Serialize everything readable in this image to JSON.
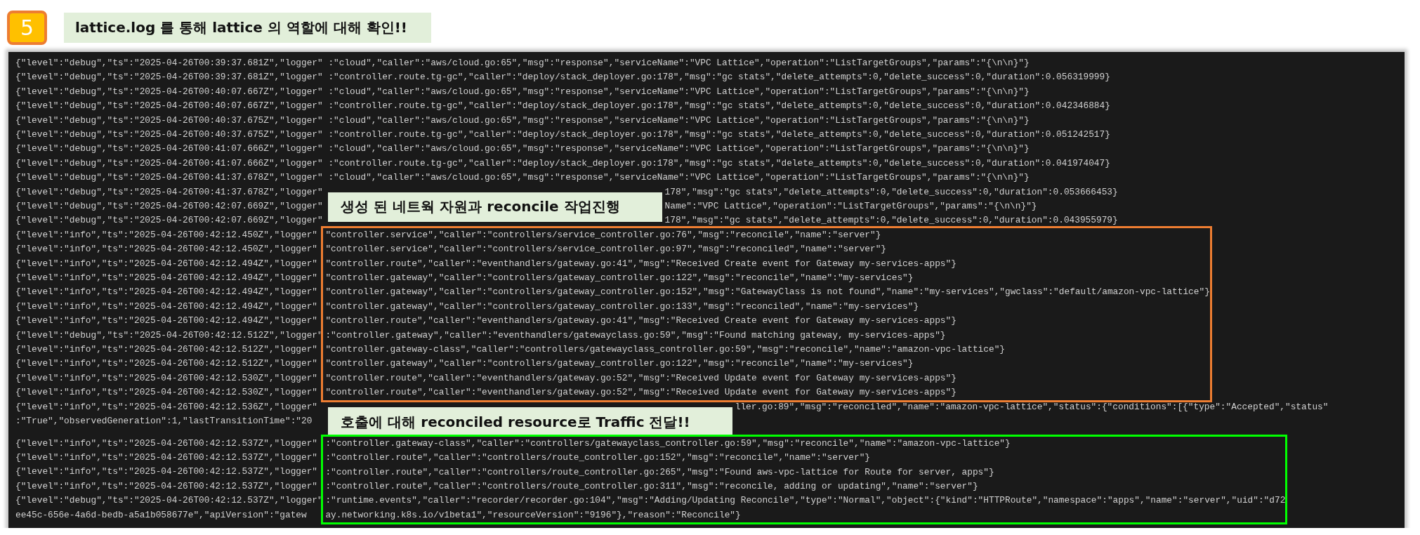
{
  "step_badge": "5",
  "title": "lattice.log 를 통해 lattice 의 역할에 대해 확인!!",
  "terminal": {
    "groups": [
      {
        "kind": "plain",
        "lines": [
          {
            "prefix": "{\"level\":\"debug\",\"ts\":\"2025-04-26T00:39:37.681Z\",\"logger\"",
            "rest": ":\"cloud\",\"caller\":\"aws/cloud.go:65\",\"msg\":\"response\",\"serviceName\":\"VPC Lattice\",\"operation\":\"ListTargetGroups\",\"params\":\"{\\n\\n}\"}"
          },
          {
            "prefix": "{\"level\":\"debug\",\"ts\":\"2025-04-26T00:39:37.681Z\",\"logger\"",
            "rest": ":\"controller.route.tg-gc\",\"caller\":\"deploy/stack_deployer.go:178\",\"msg\":\"gc stats\",\"delete_attempts\":0,\"delete_success\":0,\"duration\":0.056319999}"
          },
          {
            "prefix": "{\"level\":\"debug\",\"ts\":\"2025-04-26T00:40:07.667Z\",\"logger\"",
            "rest": ":\"cloud\",\"caller\":\"aws/cloud.go:65\",\"msg\":\"response\",\"serviceName\":\"VPC Lattice\",\"operation\":\"ListTargetGroups\",\"params\":\"{\\n\\n}\"}"
          },
          {
            "prefix": "{\"level\":\"debug\",\"ts\":\"2025-04-26T00:40:07.667Z\",\"logger\"",
            "rest": ":\"controller.route.tg-gc\",\"caller\":\"deploy/stack_deployer.go:178\",\"msg\":\"gc stats\",\"delete_attempts\":0,\"delete_success\":0,\"duration\":0.042346884}"
          },
          {
            "prefix": "{\"level\":\"debug\",\"ts\":\"2025-04-26T00:40:37.675Z\",\"logger\"",
            "rest": ":\"cloud\",\"caller\":\"aws/cloud.go:65\",\"msg\":\"response\",\"serviceName\":\"VPC Lattice\",\"operation\":\"ListTargetGroups\",\"params\":\"{\\n\\n}\"}"
          },
          {
            "prefix": "{\"level\":\"debug\",\"ts\":\"2025-04-26T00:40:37.675Z\",\"logger\"",
            "rest": ":\"controller.route.tg-gc\",\"caller\":\"deploy/stack_deployer.go:178\",\"msg\":\"gc stats\",\"delete_attempts\":0,\"delete_success\":0,\"duration\":0.051242517}"
          },
          {
            "prefix": "{\"level\":\"debug\",\"ts\":\"2025-04-26T00:41:07.666Z\",\"logger\"",
            "rest": ":\"cloud\",\"caller\":\"aws/cloud.go:65\",\"msg\":\"response\",\"serviceName\":\"VPC Lattice\",\"operation\":\"ListTargetGroups\",\"params\":\"{\\n\\n}\"}"
          },
          {
            "prefix": "{\"level\":\"debug\",\"ts\":\"2025-04-26T00:41:07.666Z\",\"logger\"",
            "rest": ":\"controller.route.tg-gc\",\"caller\":\"deploy/stack_deployer.go:178\",\"msg\":\"gc stats\",\"delete_attempts\":0,\"delete_success\":0,\"duration\":0.041974047}"
          },
          {
            "prefix": "{\"level\":\"debug\",\"ts\":\"2025-04-26T00:41:37.678Z\",\"logger\"",
            "rest": ":\"cloud\",\"caller\":\"aws/cloud.go:65\",\"msg\":\"response\",\"serviceName\":\"VPC Lattice\",\"operation\":\"ListTargetGroups\",\"params\":\"{\\n\\n}\"}"
          }
        ]
      },
      {
        "kind": "callout",
        "label": "생성 된 네트웍 자원과 reconcile 작업진행",
        "lines": [
          {
            "prefix": "{\"level\":\"debug\",\"ts\":\"2025-04-26T00:41:37.678Z\",\"logger\"",
            "rest": "178\",\"msg\":\"gc stats\",\"delete_attempts\":0,\"delete_success\":0,\"duration\":0.053666453}"
          },
          {
            "prefix": "{\"level\":\"debug\",\"ts\":\"2025-04-26T00:42:07.669Z\",\"logger\"",
            "rest": "Name\":\"VPC Lattice\",\"operation\":\"ListTargetGroups\",\"params\":\"{\\n\\n}\"}"
          },
          {
            "prefix": "{\"level\":\"debug\",\"ts\":\"2025-04-26T00:42:07.669Z\",\"logger\"",
            "rest": "178\",\"msg\":\"gc stats\",\"delete_attempts\":0,\"delete_success\":0,\"duration\":0.043955979}"
          }
        ]
      },
      {
        "kind": "box",
        "color": "#ed7d31",
        "lines": [
          {
            "prefix": "{\"level\":\"info\",\"ts\":\"2025-04-26T00:42:12.450Z\",\"logger\"",
            "rest": "\"controller.service\",\"caller\":\"controllers/service_controller.go:76\",\"msg\":\"reconcile\",\"name\":\"server\"}"
          },
          {
            "prefix": "{\"level\":\"info\",\"ts\":\"2025-04-26T00:42:12.450Z\",\"logger\"",
            "rest": "\"controller.service\",\"caller\":\"controllers/service_controller.go:97\",\"msg\":\"reconciled\",\"name\":\"server\"}"
          },
          {
            "prefix": "{\"level\":\"info\",\"ts\":\"2025-04-26T00:42:12.494Z\",\"logger\"",
            "rest": "\"controller.route\",\"caller\":\"eventhandlers/gateway.go:41\",\"msg\":\"Received Create event for Gateway my-services-apps\"}"
          },
          {
            "prefix": "{\"level\":\"info\",\"ts\":\"2025-04-26T00:42:12.494Z\",\"logger\"",
            "rest": "\"controller.gateway\",\"caller\":\"controllers/gateway_controller.go:122\",\"msg\":\"reconcile\",\"name\":\"my-services\"}"
          },
          {
            "prefix": "{\"level\":\"info\",\"ts\":\"2025-04-26T00:42:12.494Z\",\"logger\"",
            "rest": "\"controller.gateway\",\"caller\":\"controllers/gateway_controller.go:152\",\"msg\":\"GatewayClass is not found\",\"name\":\"my-services\",\"gwclass\":\"default/amazon-vpc-lattice\"}"
          },
          {
            "prefix": "{\"level\":\"info\",\"ts\":\"2025-04-26T00:42:12.494Z\",\"logger\"",
            "rest": "\"controller.gateway\",\"caller\":\"controllers/gateway_controller.go:133\",\"msg\":\"reconciled\",\"name\":\"my-services\"}"
          },
          {
            "prefix": "{\"level\":\"info\",\"ts\":\"2025-04-26T00:42:12.494Z\",\"logger\"",
            "rest": "\"controller.route\",\"caller\":\"eventhandlers/gateway.go:41\",\"msg\":\"Received Create event for Gateway my-services-apps\"}"
          },
          {
            "prefix": "{\"level\":\"debug\",\"ts\":\"2025-04-26T00:42:12.512Z\",\"logger\"",
            "rest": ":\"controller.gateway\",\"caller\":\"eventhandlers/gatewayclass.go:59\",\"msg\":\"Found matching gateway, my-services-apps\"}"
          },
          {
            "prefix": "{\"level\":\"info\",\"ts\":\"2025-04-26T00:42:12.512Z\",\"logger\"",
            "rest": "\"controller.gateway-class\",\"caller\":\"controllers/gatewayclass_controller.go:59\",\"msg\":\"reconcile\",\"name\":\"amazon-vpc-lattice\"}"
          },
          {
            "prefix": "{\"level\":\"info\",\"ts\":\"2025-04-26T00:42:12.512Z\",\"logger\"",
            "rest": "\"controller.gateway\",\"caller\":\"controllers/gateway_controller.go:122\",\"msg\":\"reconcile\",\"name\":\"my-services\"}"
          },
          {
            "prefix": "{\"level\":\"info\",\"ts\":\"2025-04-26T00:42:12.530Z\",\"logger\"",
            "rest": "\"controller.route\",\"caller\":\"eventhandlers/gateway.go:52\",\"msg\":\"Received Update event for Gateway my-services-apps\"}"
          },
          {
            "prefix": "{\"level\":\"info\",\"ts\":\"2025-04-26T00:42:12.530Z\",\"logger\"",
            "rest": "\"controller.route\",\"caller\":\"eventhandlers/gateway.go:52\",\"msg\":\"Received Update event for Gateway my-services-apps\"}"
          }
        ]
      },
      {
        "kind": "callout",
        "label": "호출에 대해 reconciled resource로 Traffic 전달!!",
        "lines": [
          {
            "prefix": "{\"level\":\"info\",\"ts\":\"2025-04-26T00:42:12.536Z\",\"logger\"",
            "rest": "ller.go:89\",\"msg\":\"reconciled\",\"name\":\"amazon-vpc-lattice\",\"status\":{\"conditions\":[{\"type\":\"Accepted\",\"status\""
          },
          {
            "prefix": ":\"True\",\"observedGeneration\":1,\"lastTransitionTime\":\"20"
          }
        ]
      },
      {
        "kind": "box",
        "color": "#00ff00",
        "lines": [
          {
            "prefix": "{\"level\":\"info\",\"ts\":\"2025-04-26T00:42:12.537Z\",\"logger\"",
            "rest": ":\"controller.gateway-class\",\"caller\":\"controllers/gatewayclass_controller.go:59\",\"msg\":\"reconcile\",\"name\":\"amazon-vpc-lattice\"}"
          },
          {
            "prefix": "{\"level\":\"info\",\"ts\":\"2025-04-26T00:42:12.537Z\",\"logger\"",
            "rest": ":\"controller.route\",\"caller\":\"controllers/route_controller.go:152\",\"msg\":\"reconcile\",\"name\":\"server\"}"
          },
          {
            "prefix": "{\"level\":\"info\",\"ts\":\"2025-04-26T00:42:12.537Z\",\"logger\"",
            "rest": ":\"controller.route\",\"caller\":\"controllers/route_controller.go:265\",\"msg\":\"Found aws-vpc-lattice for Route for server, apps\"}"
          },
          {
            "prefix": "{\"level\":\"info\",\"ts\":\"2025-04-26T00:42:12.537Z\",\"logger\"",
            "rest": ":\"controller.route\",\"caller\":\"controllers/route_controller.go:311\",\"msg\":\"reconcile, adding or updating\",\"name\":\"server\"}"
          },
          {
            "prefix": "{\"level\":\"debug\",\"ts\":\"2025-04-26T00:42:12.537Z\",\"logger\"",
            "rest": ":\"runtime.events\",\"caller\":\"recorder/recorder.go:104\",\"msg\":\"Adding/Updating Reconcile\",\"type\":\"Normal\",\"object\":{\"kind\":\"HTTPRoute\",\"namespace\":\"apps\",\"name\":\"server\",\"uid\":\"d72"
          },
          {
            "prefix": "ee45c-656e-4a6d-bedb-a5a1b058677e\",\"apiVersion\":\"gatew",
            "rest": "ay.networking.k8s.io/v1beta1\",\"resourceVersion\":\"9196\"},\"reason\":\"Reconcile\"}"
          }
        ]
      }
    ]
  }
}
